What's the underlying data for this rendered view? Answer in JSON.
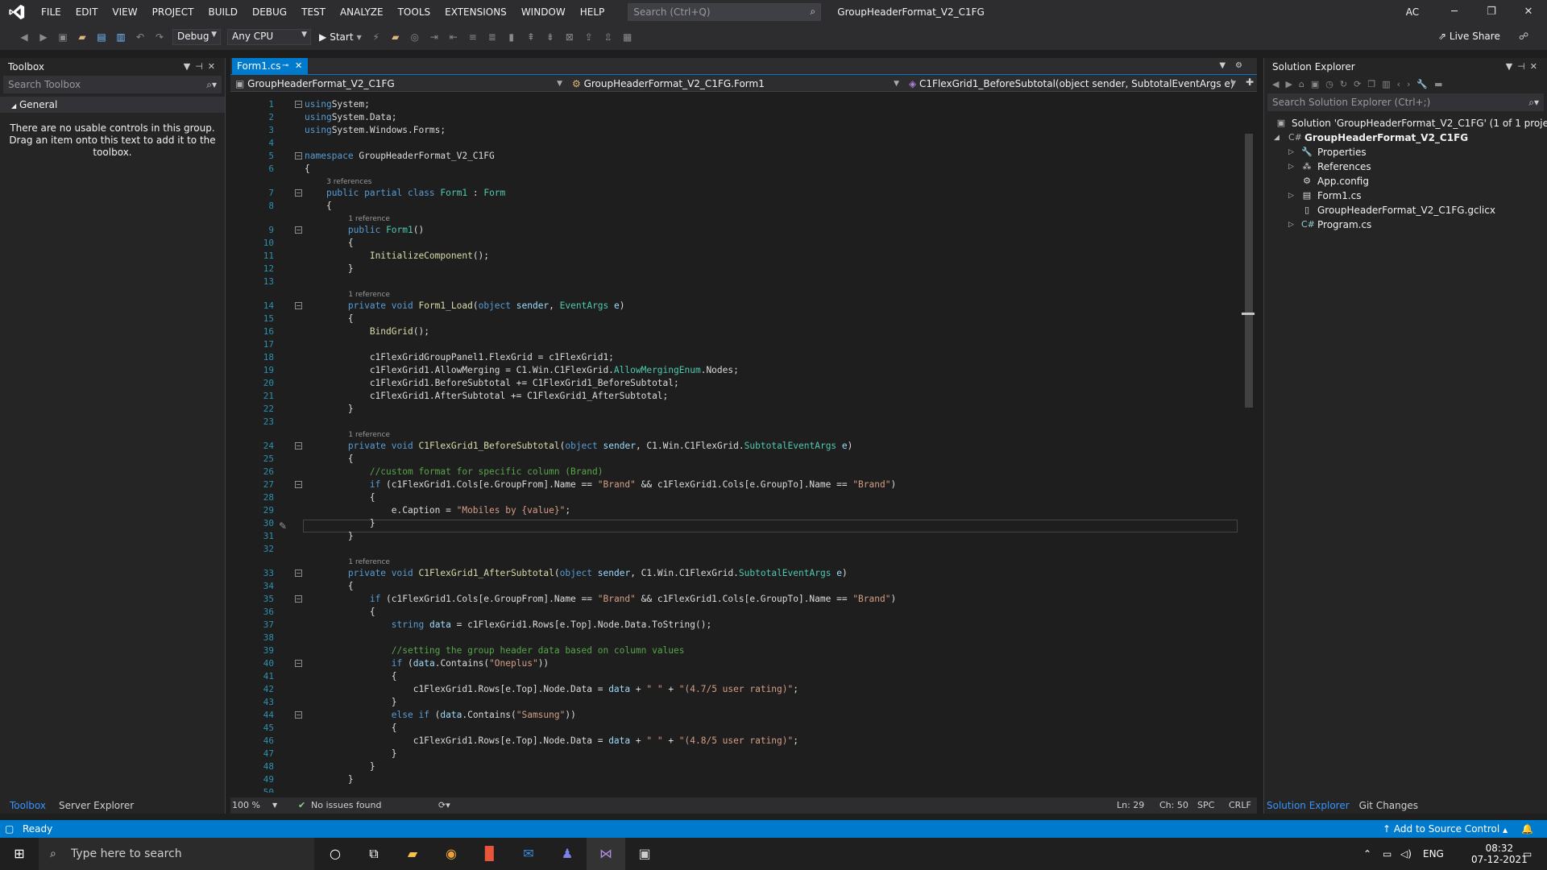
{
  "menubar": {
    "items": [
      "FILE",
      "EDIT",
      "VIEW",
      "PROJECT",
      "BUILD",
      "DEBUG",
      "TEST",
      "ANALYZE",
      "TOOLS",
      "EXTENSIONS",
      "WINDOW",
      "HELP"
    ],
    "search_placeholder": "Search (Ctrl+Q)",
    "solution_title": "GroupHeaderFormat_V2_C1FG",
    "account_initials": "AC"
  },
  "toolbar": {
    "configuration": "Debug",
    "platform": "Any CPU",
    "start_label": "Start",
    "live_share_label": "Live Share"
  },
  "toolbox": {
    "title": "Toolbox",
    "search_placeholder": "Search Toolbox",
    "group_label": "General",
    "empty_text_1": "There are no usable controls in this group.",
    "empty_text_2": "Drag an item onto this text to add it to the",
    "empty_text_3": "toolbox.",
    "tabs": [
      "Toolbox",
      "Server Explorer"
    ]
  },
  "editor": {
    "tab_label": "Form1.cs",
    "nav_project": "GroupHeaderFormat_V2_C1FG",
    "nav_class": "GroupHeaderFormat_V2_C1FG.Form1",
    "nav_member": "C1FlexGrid1_BeforeSubtotal(object sender, SubtotalEventArgs e)",
    "zoom": "100 %",
    "issues": "No issues found",
    "ln": "Ln: 29",
    "ch": "Ch: 50",
    "spc": "SPC",
    "crlf": "CRLF",
    "lens": {
      "l7": "3 references",
      "l9": "1 reference",
      "l14": "1 reference",
      "l24": "1 reference",
      "l33": "1 reference"
    }
  },
  "solution_explorer": {
    "title": "Solution Explorer",
    "search_placeholder": "Search Solution Explorer (Ctrl+;)",
    "solution_label": "Solution 'GroupHeaderFormat_V2_C1FG' (1 of 1 project)",
    "project_label": "GroupHeaderFormat_V2_C1FG",
    "items": [
      "Properties",
      "References",
      "App.config",
      "Form1.cs",
      "GroupHeaderFormat_V2_C1FG.gclicx",
      "Program.cs"
    ],
    "tabs": [
      "Solution Explorer",
      "Git Changes"
    ]
  },
  "statusbar": {
    "ready": "Ready",
    "source_control": "Add to Source Control"
  },
  "taskbar": {
    "search_placeholder": "Type here to search",
    "lang": "ENG",
    "time": "08:32",
    "date": "07-12-2021"
  }
}
